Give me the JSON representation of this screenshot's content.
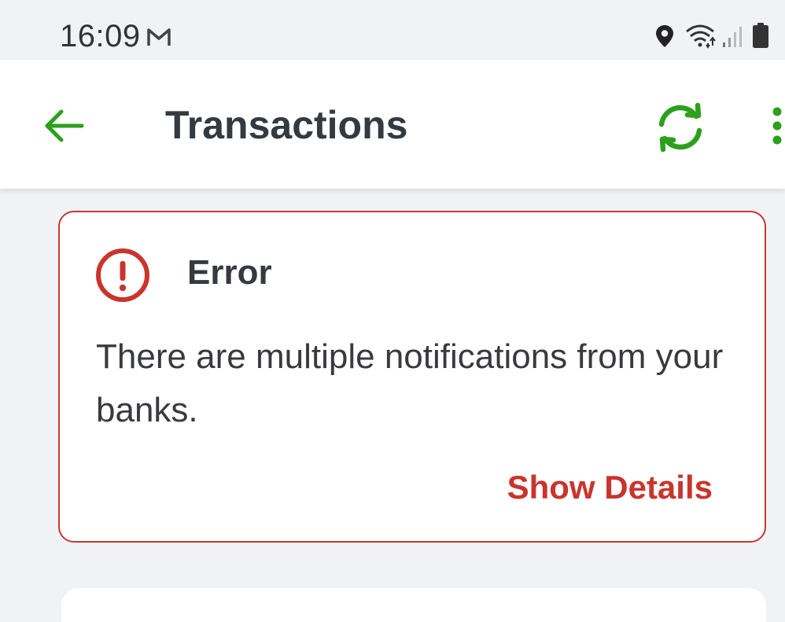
{
  "status_bar": {
    "time": "16:09",
    "notification_icon": "gmail-icon",
    "icons": [
      "location-icon",
      "wifi-icon",
      "signal-icon",
      "battery-icon"
    ]
  },
  "app_bar": {
    "title": "Transactions",
    "back_icon": "arrow-left-icon",
    "sync_icon": "sync-icon",
    "more_icon": "more-vertical-icon"
  },
  "error_card": {
    "title": "Error",
    "icon": "error-circle-icon",
    "message": "There are multiple notifications from your banks.",
    "action_label": "Show Details"
  },
  "colors": {
    "accent_green": "#2ca01c",
    "error_red": "#c9352d",
    "background": "#f0f2f6",
    "text_dark": "#333a40"
  }
}
